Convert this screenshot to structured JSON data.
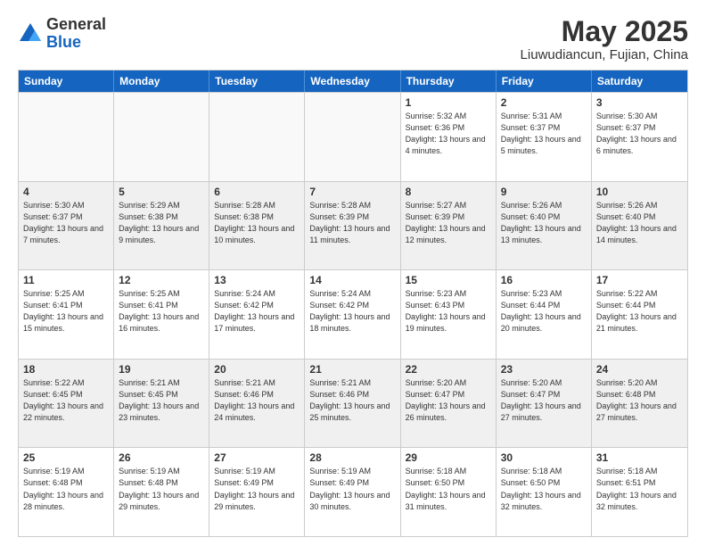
{
  "logo": {
    "general": "General",
    "blue": "Blue"
  },
  "title": "May 2025",
  "subtitle": "Liuwudiancun, Fujian, China",
  "days": [
    "Sunday",
    "Monday",
    "Tuesday",
    "Wednesday",
    "Thursday",
    "Friday",
    "Saturday"
  ],
  "weeks": [
    [
      {
        "day": "",
        "info": ""
      },
      {
        "day": "",
        "info": ""
      },
      {
        "day": "",
        "info": ""
      },
      {
        "day": "",
        "info": ""
      },
      {
        "day": "1",
        "info": "Sunrise: 5:32 AM\nSunset: 6:36 PM\nDaylight: 13 hours and 4 minutes."
      },
      {
        "day": "2",
        "info": "Sunrise: 5:31 AM\nSunset: 6:37 PM\nDaylight: 13 hours and 5 minutes."
      },
      {
        "day": "3",
        "info": "Sunrise: 5:30 AM\nSunset: 6:37 PM\nDaylight: 13 hours and 6 minutes."
      }
    ],
    [
      {
        "day": "4",
        "info": "Sunrise: 5:30 AM\nSunset: 6:37 PM\nDaylight: 13 hours and 7 minutes."
      },
      {
        "day": "5",
        "info": "Sunrise: 5:29 AM\nSunset: 6:38 PM\nDaylight: 13 hours and 9 minutes."
      },
      {
        "day": "6",
        "info": "Sunrise: 5:28 AM\nSunset: 6:38 PM\nDaylight: 13 hours and 10 minutes."
      },
      {
        "day": "7",
        "info": "Sunrise: 5:28 AM\nSunset: 6:39 PM\nDaylight: 13 hours and 11 minutes."
      },
      {
        "day": "8",
        "info": "Sunrise: 5:27 AM\nSunset: 6:39 PM\nDaylight: 13 hours and 12 minutes."
      },
      {
        "day": "9",
        "info": "Sunrise: 5:26 AM\nSunset: 6:40 PM\nDaylight: 13 hours and 13 minutes."
      },
      {
        "day": "10",
        "info": "Sunrise: 5:26 AM\nSunset: 6:40 PM\nDaylight: 13 hours and 14 minutes."
      }
    ],
    [
      {
        "day": "11",
        "info": "Sunrise: 5:25 AM\nSunset: 6:41 PM\nDaylight: 13 hours and 15 minutes."
      },
      {
        "day": "12",
        "info": "Sunrise: 5:25 AM\nSunset: 6:41 PM\nDaylight: 13 hours and 16 minutes."
      },
      {
        "day": "13",
        "info": "Sunrise: 5:24 AM\nSunset: 6:42 PM\nDaylight: 13 hours and 17 minutes."
      },
      {
        "day": "14",
        "info": "Sunrise: 5:24 AM\nSunset: 6:42 PM\nDaylight: 13 hours and 18 minutes."
      },
      {
        "day": "15",
        "info": "Sunrise: 5:23 AM\nSunset: 6:43 PM\nDaylight: 13 hours and 19 minutes."
      },
      {
        "day": "16",
        "info": "Sunrise: 5:23 AM\nSunset: 6:44 PM\nDaylight: 13 hours and 20 minutes."
      },
      {
        "day": "17",
        "info": "Sunrise: 5:22 AM\nSunset: 6:44 PM\nDaylight: 13 hours and 21 minutes."
      }
    ],
    [
      {
        "day": "18",
        "info": "Sunrise: 5:22 AM\nSunset: 6:45 PM\nDaylight: 13 hours and 22 minutes."
      },
      {
        "day": "19",
        "info": "Sunrise: 5:21 AM\nSunset: 6:45 PM\nDaylight: 13 hours and 23 minutes."
      },
      {
        "day": "20",
        "info": "Sunrise: 5:21 AM\nSunset: 6:46 PM\nDaylight: 13 hours and 24 minutes."
      },
      {
        "day": "21",
        "info": "Sunrise: 5:21 AM\nSunset: 6:46 PM\nDaylight: 13 hours and 25 minutes."
      },
      {
        "day": "22",
        "info": "Sunrise: 5:20 AM\nSunset: 6:47 PM\nDaylight: 13 hours and 26 minutes."
      },
      {
        "day": "23",
        "info": "Sunrise: 5:20 AM\nSunset: 6:47 PM\nDaylight: 13 hours and 27 minutes."
      },
      {
        "day": "24",
        "info": "Sunrise: 5:20 AM\nSunset: 6:48 PM\nDaylight: 13 hours and 27 minutes."
      }
    ],
    [
      {
        "day": "25",
        "info": "Sunrise: 5:19 AM\nSunset: 6:48 PM\nDaylight: 13 hours and 28 minutes."
      },
      {
        "day": "26",
        "info": "Sunrise: 5:19 AM\nSunset: 6:48 PM\nDaylight: 13 hours and 29 minutes."
      },
      {
        "day": "27",
        "info": "Sunrise: 5:19 AM\nSunset: 6:49 PM\nDaylight: 13 hours and 29 minutes."
      },
      {
        "day": "28",
        "info": "Sunrise: 5:19 AM\nSunset: 6:49 PM\nDaylight: 13 hours and 30 minutes."
      },
      {
        "day": "29",
        "info": "Sunrise: 5:18 AM\nSunset: 6:50 PM\nDaylight: 13 hours and 31 minutes."
      },
      {
        "day": "30",
        "info": "Sunrise: 5:18 AM\nSunset: 6:50 PM\nDaylight: 13 hours and 32 minutes."
      },
      {
        "day": "31",
        "info": "Sunrise: 5:18 AM\nSunset: 6:51 PM\nDaylight: 13 hours and 32 minutes."
      }
    ]
  ]
}
